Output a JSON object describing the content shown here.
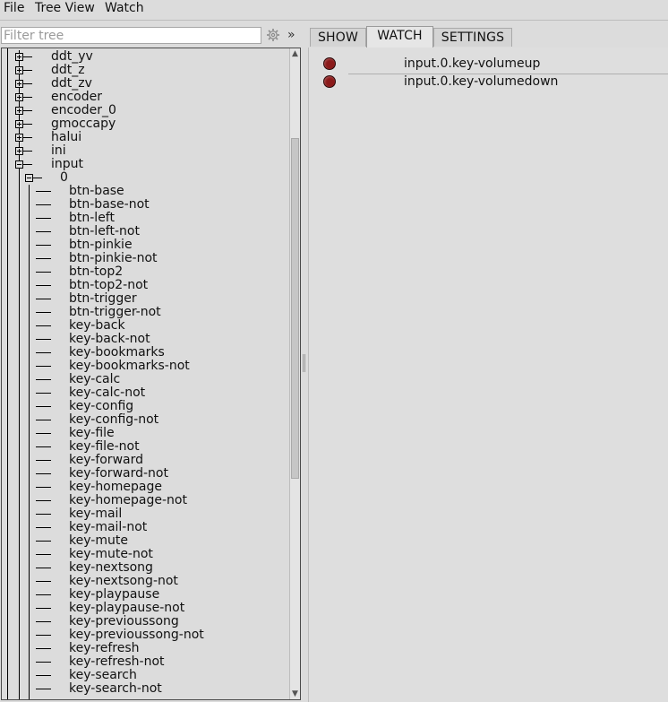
{
  "menubar": {
    "items": [
      {
        "label": "File"
      },
      {
        "label": "Tree View"
      },
      {
        "label": "Watch"
      }
    ]
  },
  "filter": {
    "placeholder": "Filter tree",
    "value": "",
    "more_glyph": "»",
    "settings_icon": "gear-icon"
  },
  "tree": {
    "top_level": [
      {
        "label": "ddt_yv",
        "expanded": false
      },
      {
        "label": "ddt_z",
        "expanded": false
      },
      {
        "label": "ddt_zv",
        "expanded": false
      },
      {
        "label": "encoder",
        "expanded": false
      },
      {
        "label": "encoder_0",
        "expanded": false
      },
      {
        "label": "gmoccapy",
        "expanded": false
      },
      {
        "label": "halui",
        "expanded": false
      },
      {
        "label": "ini",
        "expanded": false
      },
      {
        "label": "input",
        "expanded": true
      }
    ],
    "input_child": {
      "label": "0",
      "expanded": true
    },
    "leaves": [
      "btn-base",
      "btn-base-not",
      "btn-left",
      "btn-left-not",
      "btn-pinkie",
      "btn-pinkie-not",
      "btn-top2",
      "btn-top2-not",
      "btn-trigger",
      "btn-trigger-not",
      "key-back",
      "key-back-not",
      "key-bookmarks",
      "key-bookmarks-not",
      "key-calc",
      "key-calc-not",
      "key-config",
      "key-config-not",
      "key-file",
      "key-file-not",
      "key-forward",
      "key-forward-not",
      "key-homepage",
      "key-homepage-not",
      "key-mail",
      "key-mail-not",
      "key-mute",
      "key-mute-not",
      "key-nextsong",
      "key-nextsong-not",
      "key-playpause",
      "key-playpause-not",
      "key-previoussong",
      "key-previoussong-not",
      "key-refresh",
      "key-refresh-not",
      "key-search",
      "key-search-not"
    ]
  },
  "tabs": [
    {
      "label": "SHOW",
      "active": false
    },
    {
      "label": "WATCH",
      "active": true
    },
    {
      "label": "SETTINGS",
      "active": false
    }
  ],
  "watch": {
    "items": [
      {
        "label": "input.0.key-volumeup",
        "led_color": "#8b1a1a",
        "state": "off"
      },
      {
        "label": "input.0.key-volumedown",
        "led_color": "#8b1a1a",
        "state": "off"
      }
    ]
  },
  "colors": {
    "background": "#dcdcdc",
    "led_off": "#8b1a1a"
  }
}
